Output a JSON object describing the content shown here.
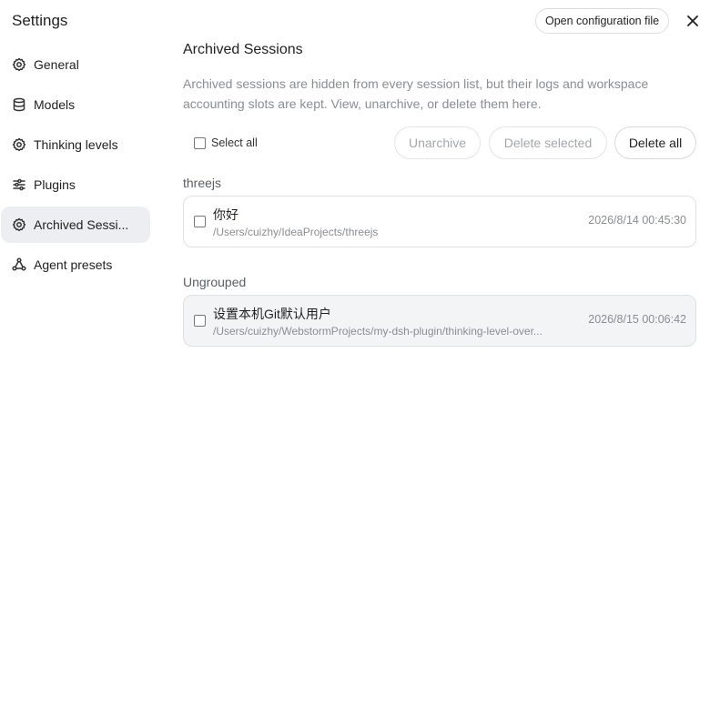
{
  "sidebar": {
    "title": "Settings",
    "items": [
      {
        "label": "General",
        "icon": "gear-icon",
        "active": false
      },
      {
        "label": "Models",
        "icon": "database-icon",
        "active": false
      },
      {
        "label": "Thinking levels",
        "icon": "gear-icon",
        "active": false
      },
      {
        "label": "Plugins",
        "icon": "sliders-icon",
        "active": false
      },
      {
        "label": "Archived Sessi...",
        "icon": "gear-icon",
        "active": true
      },
      {
        "label": "Agent presets",
        "icon": "network-icon",
        "active": false
      }
    ]
  },
  "header": {
    "open_config_label": "Open configuration file",
    "close_icon": "close-icon"
  },
  "main": {
    "title": "Archived Sessions",
    "description": "Archived sessions are hidden from every session list, but their logs and workspace accounting slots are kept. View, unarchive, or delete them here.",
    "toolbar": {
      "select_all_label": "Select all",
      "unarchive_label": "Unarchive",
      "delete_selected_label": "Delete selected",
      "delete_all_label": "Delete all"
    },
    "groups": [
      {
        "label": "threejs",
        "sessions": [
          {
            "title": "你好",
            "path": "/Users/cuizhy/IdeaProjects/threejs",
            "time": "2026/8/14 00:45:30"
          }
        ]
      },
      {
        "label": "Ungrouped",
        "sessions": [
          {
            "title": "设置本机Git默认用户",
            "path": "/Users/cuizhy/WebstormProjects/my-dsh-plugin/thinking-level-over...",
            "time": "2026/8/15 00:06:42"
          }
        ]
      }
    ]
  }
}
